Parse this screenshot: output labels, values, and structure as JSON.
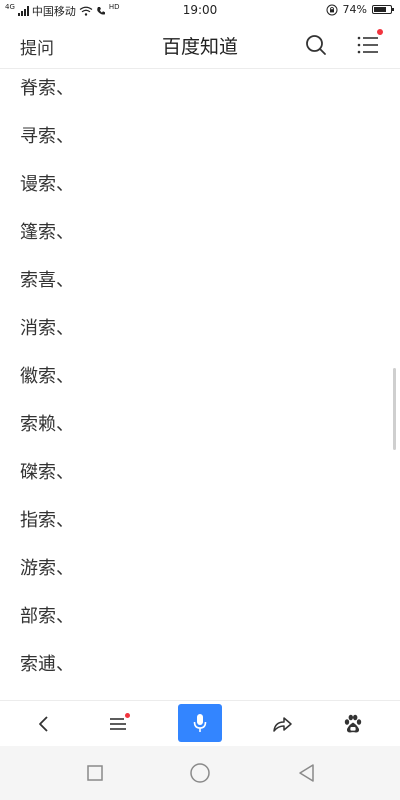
{
  "status_bar": {
    "network_label": "4G",
    "carrier": "中国移动",
    "hd_label": "HD",
    "time": "19:00",
    "battery_percent": "74%",
    "battery_level": 0.74
  },
  "header": {
    "left_label": "提问",
    "title": "百度知道"
  },
  "content": {
    "lines": [
      "脊索、",
      "寻索、",
      "谩索、",
      "篷索、",
      "索喜、",
      "消索、",
      "徽索、",
      "索赖、",
      "磔索、",
      "指索、",
      "游索、",
      "部索、",
      "索逋、"
    ]
  },
  "colors": {
    "accent": "#3385ff",
    "notification": "#f2343e",
    "text": "#333333",
    "nav_background": "#f5f5f5"
  },
  "icons": {
    "header": [
      "search-icon",
      "menu-icon"
    ],
    "toolbar": [
      "back-icon",
      "list-menu-icon",
      "microphone-icon",
      "share-icon",
      "baidu-paw-icon"
    ],
    "system_nav": [
      "recent-apps-icon",
      "home-icon",
      "back-triangle-icon"
    ]
  }
}
